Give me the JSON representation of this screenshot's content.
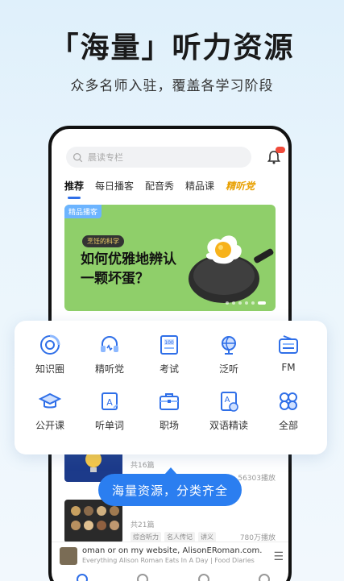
{
  "promo": {
    "headline": "「海量」听力资源",
    "subline": "众多名师入驻，覆盖各学习阶段",
    "tooltip": "海量资源，分类齐全"
  },
  "app": {
    "search_placeholder": "晨读专栏",
    "tabs": [
      {
        "label": "推荐",
        "active": true
      },
      {
        "label": "每日播客"
      },
      {
        "label": "配音秀"
      },
      {
        "label": "精品课"
      },
      {
        "label": "精听党"
      }
    ],
    "banner": {
      "tag": "精品播客",
      "pill": "烹饪的科学",
      "title": "如何优雅地辨认一颗坏蛋？",
      "bg_color": "#8fcf6a"
    },
    "categories": [
      {
        "label": "知识圈",
        "icon": "knowledge-circle-icon"
      },
      {
        "label": "精听党",
        "icon": "headphones-icon"
      },
      {
        "label": "考试",
        "icon": "exam-icon"
      },
      {
        "label": "泛听",
        "icon": "globe-icon"
      },
      {
        "label": "FM",
        "icon": "radio-icon"
      },
      {
        "label": "公开课",
        "icon": "graduation-cap-icon"
      },
      {
        "label": "听单词",
        "icon": "word-card-icon"
      },
      {
        "label": "职场",
        "icon": "briefcase-icon"
      },
      {
        "label": "双语精读",
        "icon": "bilingual-doc-icon"
      },
      {
        "label": "全部",
        "icon": "grid-all-icon"
      }
    ],
    "list": [
      {
        "meta": "共16篇",
        "plays": "56303播放"
      },
      {
        "meta": "共21篇",
        "plays": "780万播放",
        "tags": [
          "综合听力",
          "名人传记",
          "讲义"
        ]
      }
    ],
    "player": {
      "title": "oman or on my website, AlisonERoman.com.",
      "subtitle": "Everything Alison Roman Eats In A Day | Food Diaries"
    },
    "accent_color": "#2f6fe8"
  }
}
